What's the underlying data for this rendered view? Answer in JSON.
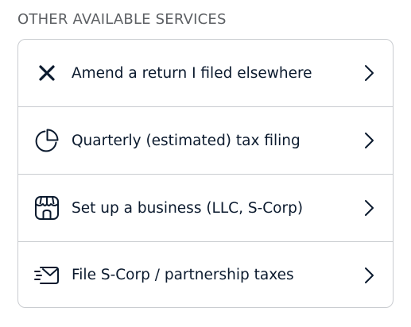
{
  "section": {
    "title": "OTHER AVAILABLE SERVICES"
  },
  "services": [
    {
      "label": "Amend a return I filed elsewhere",
      "icon": "close-x-icon"
    },
    {
      "label": "Quarterly (estimated) tax filing",
      "icon": "pie-chart-icon"
    },
    {
      "label": "Set up a business (LLC, S-Corp)",
      "icon": "storefront-icon"
    },
    {
      "label": "File S-Corp / partnership taxes",
      "icon": "fast-mail-icon"
    }
  ],
  "colors": {
    "text": "#0b1a2e",
    "title": "#5c5f63",
    "border": "#c9ccd0"
  }
}
